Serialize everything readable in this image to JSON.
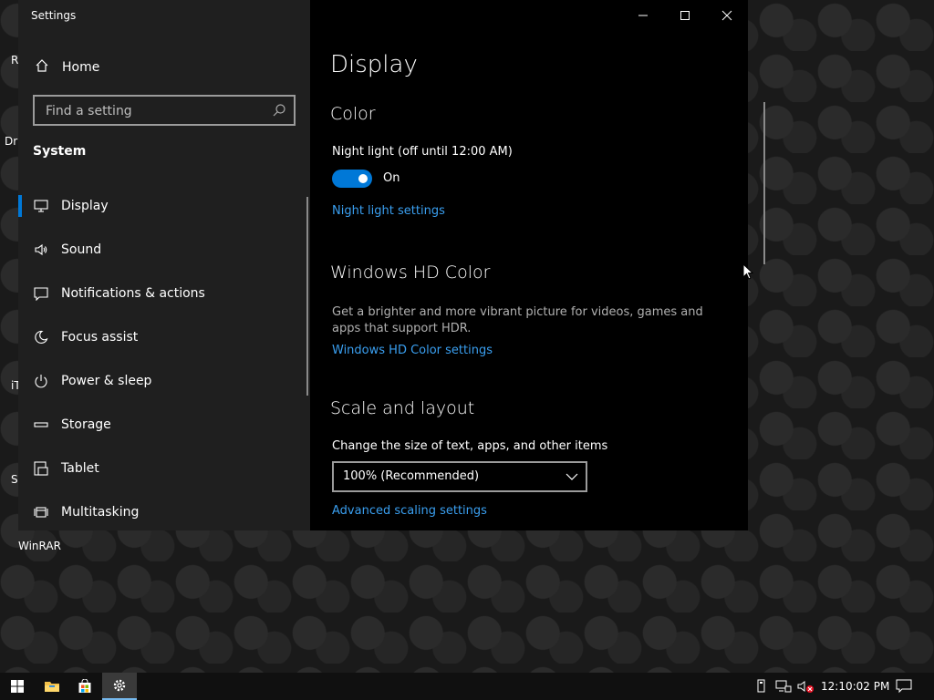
{
  "desktop": {
    "icons": [
      {
        "label": "R"
      },
      {
        "label": "Dri"
      },
      {
        "label": "iT"
      },
      {
        "label": "S"
      },
      {
        "label": "WinRAR"
      }
    ]
  },
  "window": {
    "title": "Settings",
    "controls": [
      "minimize-icon",
      "maximize-icon",
      "close-icon"
    ]
  },
  "sidebar": {
    "home_label": "Home",
    "search_placeholder": "Find a setting",
    "section": "System",
    "items": [
      {
        "label": "Display",
        "icon": "monitor-icon",
        "selected": true
      },
      {
        "label": "Sound",
        "icon": "speaker-icon"
      },
      {
        "label": "Notifications & actions",
        "icon": "notification-icon"
      },
      {
        "label": "Focus assist",
        "icon": "moon-icon"
      },
      {
        "label": "Power & sleep",
        "icon": "power-icon"
      },
      {
        "label": "Storage",
        "icon": "storage-icon"
      },
      {
        "label": "Tablet",
        "icon": "tablet-icon"
      },
      {
        "label": "Multitasking",
        "icon": "multitasking-icon"
      }
    ]
  },
  "main": {
    "page_title": "Display",
    "color": {
      "heading": "Color",
      "night_light_label": "Night light (off until 12:00 AM)",
      "toggle_state": "On",
      "night_light_link": "Night light settings"
    },
    "hdr": {
      "heading": "Windows HD Color",
      "description": "Get a brighter and more vibrant picture for videos, games and apps that support HDR.",
      "link": "Windows HD Color settings"
    },
    "scale": {
      "heading": "Scale and layout",
      "label": "Change the size of text, apps, and other items",
      "selected": "100% (Recommended)",
      "advanced_link": "Advanced scaling settings"
    }
  },
  "taskbar": {
    "time": "12:10:02 PM",
    "buttons": [
      "windows-start-icon",
      "file-explorer-icon",
      "store-icon",
      "settings-icon"
    ]
  },
  "colors": {
    "accent": "#0078d7",
    "link": "#3a9ff0",
    "sidebar_bg": "#1f1f1f",
    "content_bg": "#000000"
  }
}
